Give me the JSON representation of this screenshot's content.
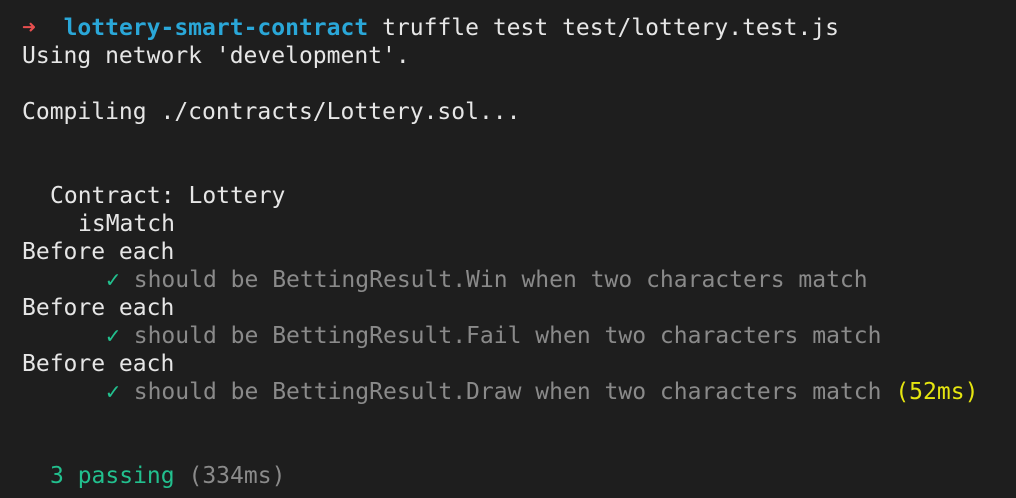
{
  "colors": {
    "background": "#1e1e1e",
    "foreground": "#e6e6e6",
    "prompt_arrow": "#e84f4f",
    "prompt_dir": "#2aa7d8",
    "pass_check": "#22c08e",
    "dim_text": "#8a8a8a",
    "slow_time": "#e5e510"
  },
  "prompt": {
    "arrow": "➜",
    "directory": "lottery-smart-contract",
    "command": "truffle test test/lottery.test.js"
  },
  "network_line": "Using network 'development'.",
  "compile_line": "Compiling ./contracts/Lottery.sol...",
  "suite": {
    "contract_label": "Contract: Lottery",
    "describe_label": "isMatch"
  },
  "tests": [
    {
      "hook": "Before each",
      "check": "✓",
      "title": "should be BettingResult.Win when two characters match",
      "duration": ""
    },
    {
      "hook": "Before each",
      "check": "✓",
      "title": "should be BettingResult.Fail when two characters match",
      "duration": ""
    },
    {
      "hook": "Before each",
      "check": "✓",
      "title": "should be BettingResult.Draw when two characters match",
      "duration": "(52ms)"
    }
  ],
  "summary": {
    "passing": "3 passing",
    "time": "(334ms)"
  }
}
